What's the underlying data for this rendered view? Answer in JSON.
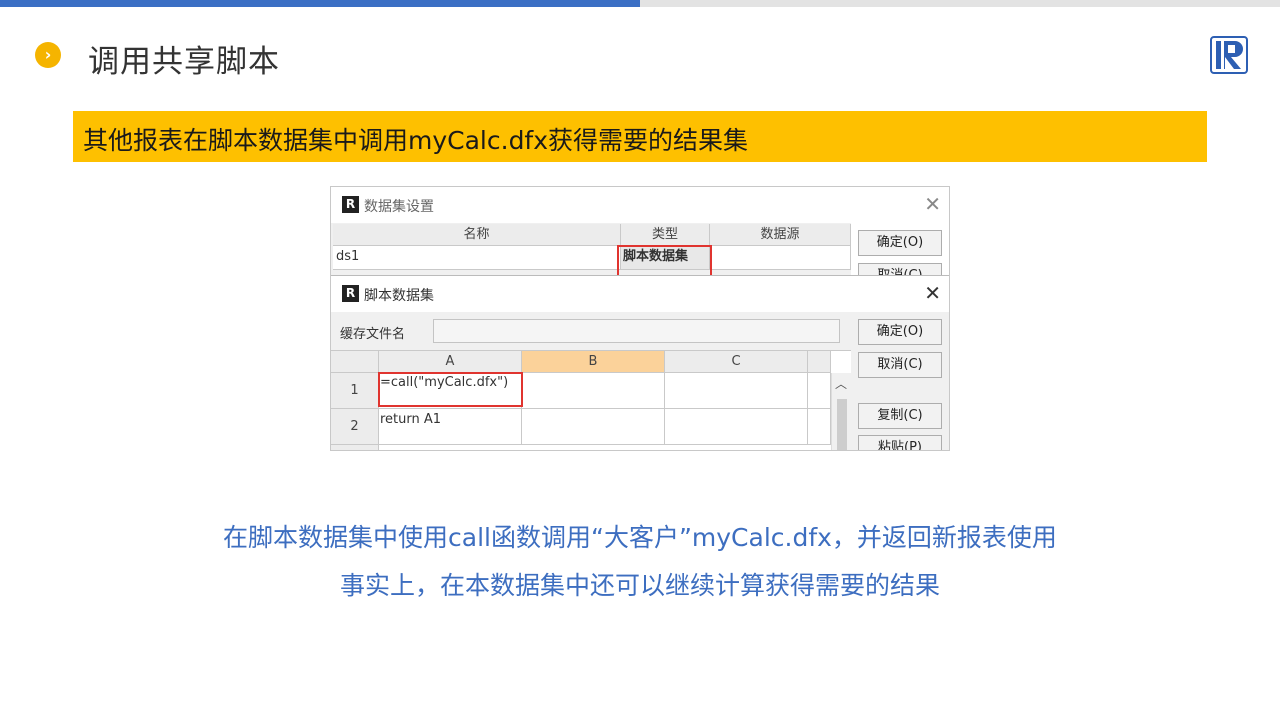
{
  "slide": {
    "title": "调用共享脚本",
    "bullet_icon": "chevron-right-icon",
    "banner": "其他报表在脚本数据集中调用myCalc.dfx获得需要的结果集",
    "captions": [
      "在脚本数据集中使用call函数调用“大客户”myCalc.dfx，并返回新报表使用",
      "事实上，在本数据集中还可以继续计算获得需要的结果"
    ],
    "colors": {
      "accent_blue": "#3b6fc4",
      "banner_yellow": "#fec000",
      "bullet": "#f5b400",
      "caption": "#3d6ec0"
    }
  },
  "dataset_dialog": {
    "title": "数据集设置",
    "columns": [
      "名称",
      "类型",
      "数据源"
    ],
    "row": [
      "ds1",
      "脚本数据集",
      ""
    ],
    "ok_button": "确定(O)",
    "cancel_button": "取消(C)"
  },
  "script_dialog": {
    "title": "脚本数据集",
    "cache_label": "缓存文件名",
    "cache_value": "",
    "columns": [
      "A",
      "B",
      "C"
    ],
    "rows": [
      {
        "num": "1",
        "a": "=call(\"myCalc.dfx\")"
      },
      {
        "num": "2",
        "a": "return A1"
      }
    ],
    "buttons": [
      "确定(O)",
      "取消(C)",
      "复制(C)",
      "粘贴(P)"
    ]
  }
}
